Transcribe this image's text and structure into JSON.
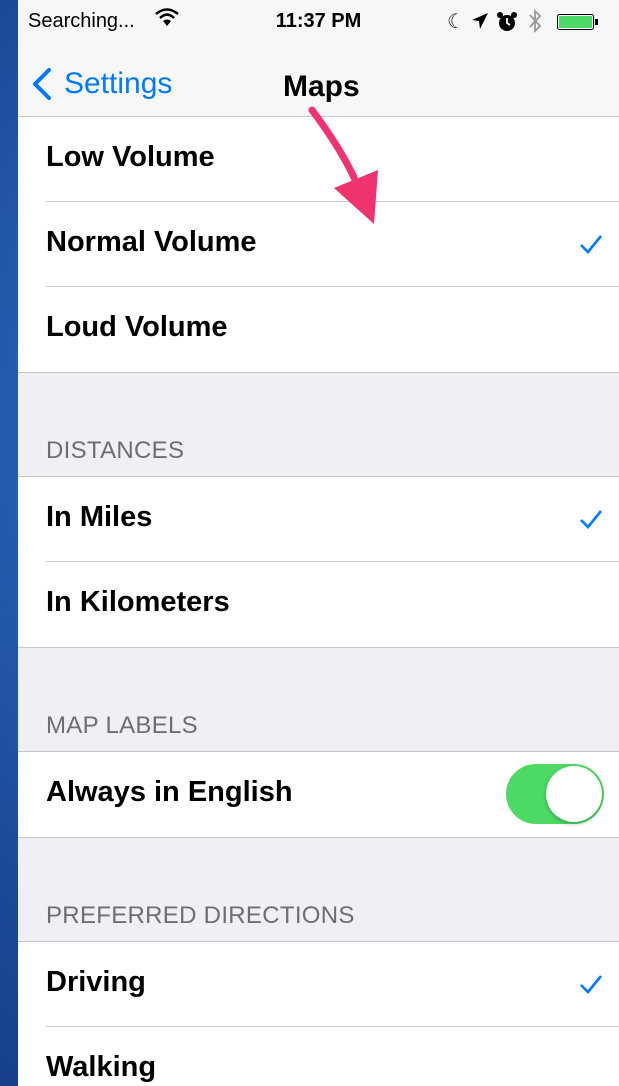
{
  "status_bar": {
    "carrier": "Searching...",
    "time": "11:37 PM",
    "icons": [
      "wifi-icon",
      "moon-icon",
      "location-icon",
      "alarm-icon",
      "bluetooth-icon",
      "battery-icon"
    ]
  },
  "nav": {
    "back_label": "Settings",
    "title": "Maps"
  },
  "volume": {
    "items": [
      {
        "label": "Low Volume",
        "checked": false
      },
      {
        "label": "Normal Volume",
        "checked": true
      },
      {
        "label": "Loud Volume",
        "checked": false
      }
    ]
  },
  "distances": {
    "header": "DISTANCES",
    "items": [
      {
        "label": "In Miles",
        "checked": true
      },
      {
        "label": "In Kilometers",
        "checked": false
      }
    ]
  },
  "map_labels": {
    "header": "MAP LABELS",
    "items": [
      {
        "label": "Always in English",
        "toggle_on": true
      }
    ]
  },
  "preferred_directions": {
    "header": "PREFERRED DIRECTIONS",
    "items": [
      {
        "label": "Driving",
        "checked": true
      },
      {
        "label": "Walking",
        "checked": false
      }
    ]
  },
  "colors": {
    "accent": "#007aff",
    "toggle_on": "#4cd964",
    "annotation_arrow": "#f0326e"
  }
}
